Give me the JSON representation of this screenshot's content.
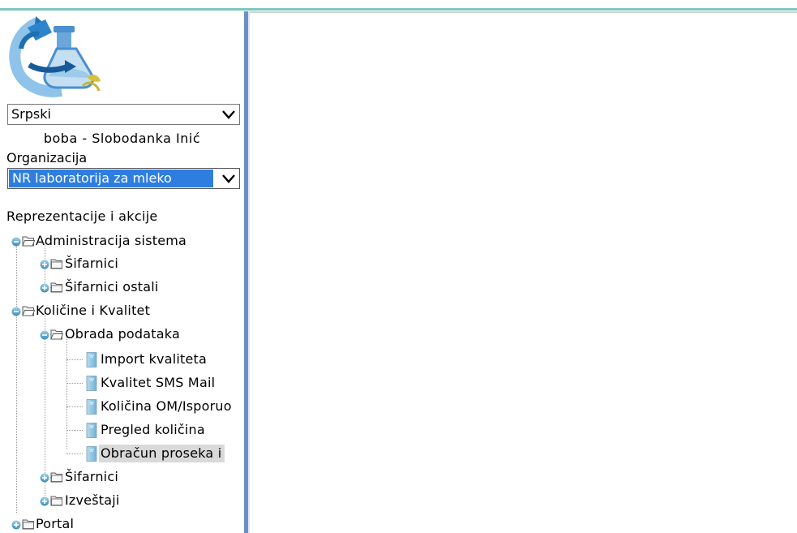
{
  "language": {
    "selected": "Srpski"
  },
  "user": {
    "display": "boba - Slobodanka Inić"
  },
  "organization": {
    "label": "Organizacija",
    "selected": "NR laboratorija za mleko"
  },
  "representations": {
    "label": "Reprezentacije i akcije"
  },
  "tree": {
    "admin": "Administracija sistema",
    "admin_sifarnici": "Šifarnici",
    "admin_sifarnici_ostali": "Šifarnici ostali",
    "kolicine": "Količine i Kvalitet",
    "obrada": "Obrada podataka",
    "import": "Import kvaliteta",
    "sms": "Kvalitet SMS Mail",
    "kolicina_om": "Količina OM/Isporuo",
    "pregled": "Pregled količina",
    "obracun": "Obračun proseka i",
    "kol_sifarnici": "Šifarnici",
    "izvestaji": "Izveštaji",
    "portal": "Portal"
  },
  "colors": {
    "top_strip": "#7cc7c0",
    "divider": "#6d91c6",
    "selection": "#2e7ee0",
    "selected_row": "#d9d9d9"
  },
  "icons": {
    "logo": "lab-flask-logo",
    "expand": "plus-toggle-icon",
    "collapse": "minus-toggle-icon",
    "folder_open": "folder-open-icon",
    "folder_closed": "folder-closed-icon",
    "document": "document-icon",
    "dropdown": "chevron-down-icon"
  }
}
